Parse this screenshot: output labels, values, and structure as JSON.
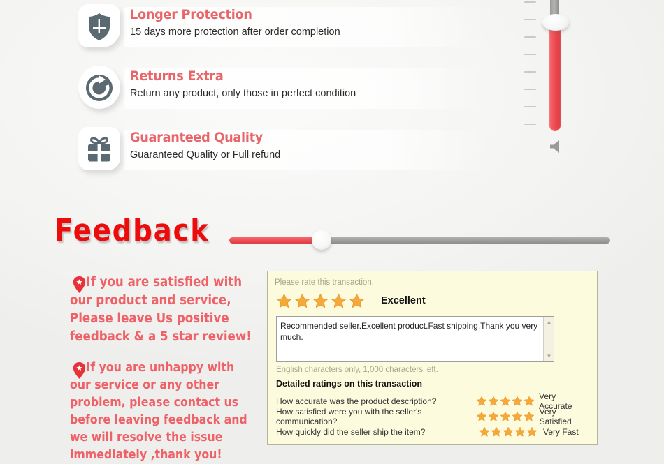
{
  "features": [
    {
      "icon": "shield-icon",
      "title": "Longer Protection",
      "desc": "15 days more protection after order completion"
    },
    {
      "icon": "return-arrow-icon",
      "title": "Returns Extra",
      "desc": "Return any product, only those in perfect condition"
    },
    {
      "icon": "gift-box-icon",
      "title": "Guaranteed Quality",
      "desc": "Guaranteed Quality or Full refund"
    }
  ],
  "volume_slider": {
    "orientation": "vertical",
    "tick_count": 8,
    "speaker_icon": "speaker-icon"
  },
  "heading": {
    "text": "Feedback"
  },
  "progress_slider": {
    "orientation": "horizontal",
    "fill_percent": 24
  },
  "messages": [
    {
      "icon": "map-pin-star-icon",
      "text": "If you are satisfied with our product and service, Please leave Us positive feedback & a 5 star review!"
    },
    {
      "icon": "map-pin-star-icon",
      "text": "If you are unhappy with our service or any other problem, please contact us before leaving feedback and we will resolve the issue immediately ,thank you!"
    }
  ],
  "feedback_form": {
    "prompt": "Please rate this transaction.",
    "overall_stars": 5,
    "overall_label": "Excellent",
    "comment": "Recommended seller.Excellent product.Fast shipping.Thank you very much.",
    "char_count_note": "English characters only, 1,000 characters left.",
    "detail_title": "Detailed ratings on this transaction",
    "detail_rows": [
      {
        "question": "How accurate was the product description?",
        "stars": 5,
        "label": "Very Accurate"
      },
      {
        "question": "How satisfied were you with the seller's communication?",
        "stars": 5,
        "label": "Very Satisfied"
      },
      {
        "question": "How quickly did the seller ship the item?",
        "stars": 5,
        "label": "Very Fast"
      }
    ]
  },
  "colors": {
    "accent_red": "#ef6166",
    "heading_red": "#ee0b0b",
    "icon_grey": "#5a6a70",
    "star_orange": "#f4a93a",
    "panel_bg": "#fdfbdd"
  }
}
